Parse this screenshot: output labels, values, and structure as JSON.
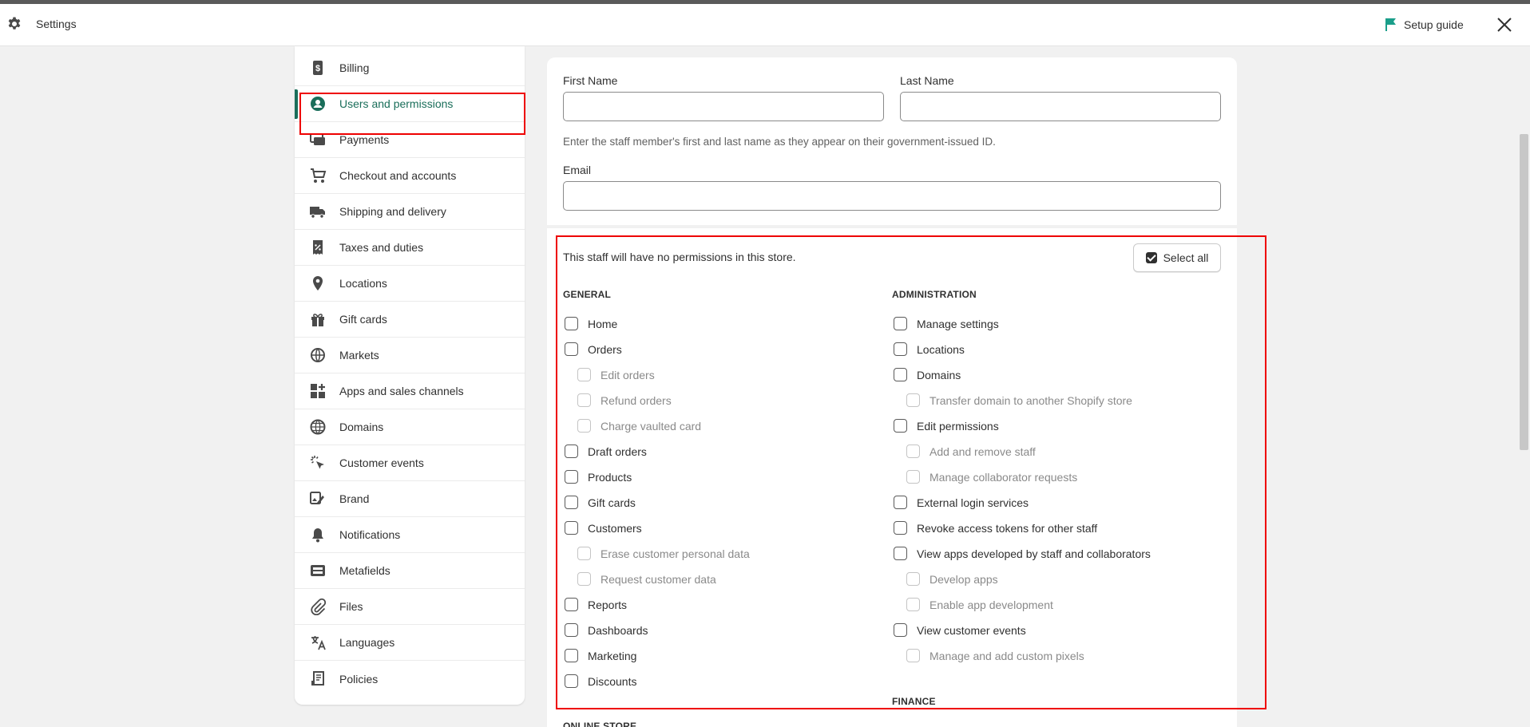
{
  "topbar": {
    "title": "Settings",
    "setup_guide": "Setup guide"
  },
  "sidebar": {
    "items": [
      {
        "label": "Billing",
        "icon": "billing-icon"
      },
      {
        "label": "Users and permissions",
        "icon": "user-icon",
        "active": true
      },
      {
        "label": "Payments",
        "icon": "payments-icon"
      },
      {
        "label": "Checkout and accounts",
        "icon": "cart-icon"
      },
      {
        "label": "Shipping and delivery",
        "icon": "truck-icon"
      },
      {
        "label": "Taxes and duties",
        "icon": "receipt-icon"
      },
      {
        "label": "Locations",
        "icon": "location-pin-icon"
      },
      {
        "label": "Gift cards",
        "icon": "gift-icon"
      },
      {
        "label": "Markets",
        "icon": "globe-icon"
      },
      {
        "label": "Apps and sales channels",
        "icon": "apps-icon"
      },
      {
        "label": "Domains",
        "icon": "domain-globe-icon"
      },
      {
        "label": "Customer events",
        "icon": "cursor-click-icon"
      },
      {
        "label": "Brand",
        "icon": "brand-icon"
      },
      {
        "label": "Notifications",
        "icon": "bell-icon"
      },
      {
        "label": "Metafields",
        "icon": "metafields-icon"
      },
      {
        "label": "Files",
        "icon": "paperclip-icon"
      },
      {
        "label": "Languages",
        "icon": "translate-icon"
      },
      {
        "label": "Policies",
        "icon": "policy-icon"
      }
    ]
  },
  "form": {
    "first_name_label": "First Name",
    "first_name_value": "",
    "last_name_label": "Last Name",
    "last_name_value": "",
    "name_help": "Enter the staff member's first and last name as they appear on their government-issued ID.",
    "email_label": "Email",
    "email_value": ""
  },
  "permissions": {
    "summary": "This staff will have no permissions in this store.",
    "select_all_label": "Select all",
    "general_heading": "GENERAL",
    "general": [
      {
        "label": "Home",
        "sub": false
      },
      {
        "label": "Orders",
        "sub": false
      },
      {
        "label": "Edit orders",
        "sub": true
      },
      {
        "label": "Refund orders",
        "sub": true
      },
      {
        "label": "Charge vaulted card",
        "sub": true
      },
      {
        "label": "Draft orders",
        "sub": false
      },
      {
        "label": "Products",
        "sub": false
      },
      {
        "label": "Gift cards",
        "sub": false
      },
      {
        "label": "Customers",
        "sub": false
      },
      {
        "label": "Erase customer personal data",
        "sub": true
      },
      {
        "label": "Request customer data",
        "sub": true
      },
      {
        "label": "Reports",
        "sub": false
      },
      {
        "label": "Dashboards",
        "sub": false
      },
      {
        "label": "Marketing",
        "sub": false
      },
      {
        "label": "Discounts",
        "sub": false
      }
    ],
    "administration_heading": "ADMINISTRATION",
    "administration": [
      {
        "label": "Manage settings",
        "sub": false
      },
      {
        "label": "Locations",
        "sub": false
      },
      {
        "label": "Domains",
        "sub": false
      },
      {
        "label": "Transfer domain to another Shopify store",
        "sub": true
      },
      {
        "label": "Edit permissions",
        "sub": false
      },
      {
        "label": "Add and remove staff",
        "sub": true
      },
      {
        "label": "Manage collaborator requests",
        "sub": true
      },
      {
        "label": "External login services",
        "sub": false
      },
      {
        "label": "Revoke access tokens for other staff",
        "sub": false
      },
      {
        "label": "View apps developed by staff and collaborators",
        "sub": false
      },
      {
        "label": "Develop apps",
        "sub": true
      },
      {
        "label": "Enable app development",
        "sub": true
      },
      {
        "label": "View customer events",
        "sub": false
      },
      {
        "label": "Manage and add custom pixels",
        "sub": true
      }
    ],
    "finance_heading": "FINANCE",
    "online_store_heading": "ONLINE STORE"
  }
}
